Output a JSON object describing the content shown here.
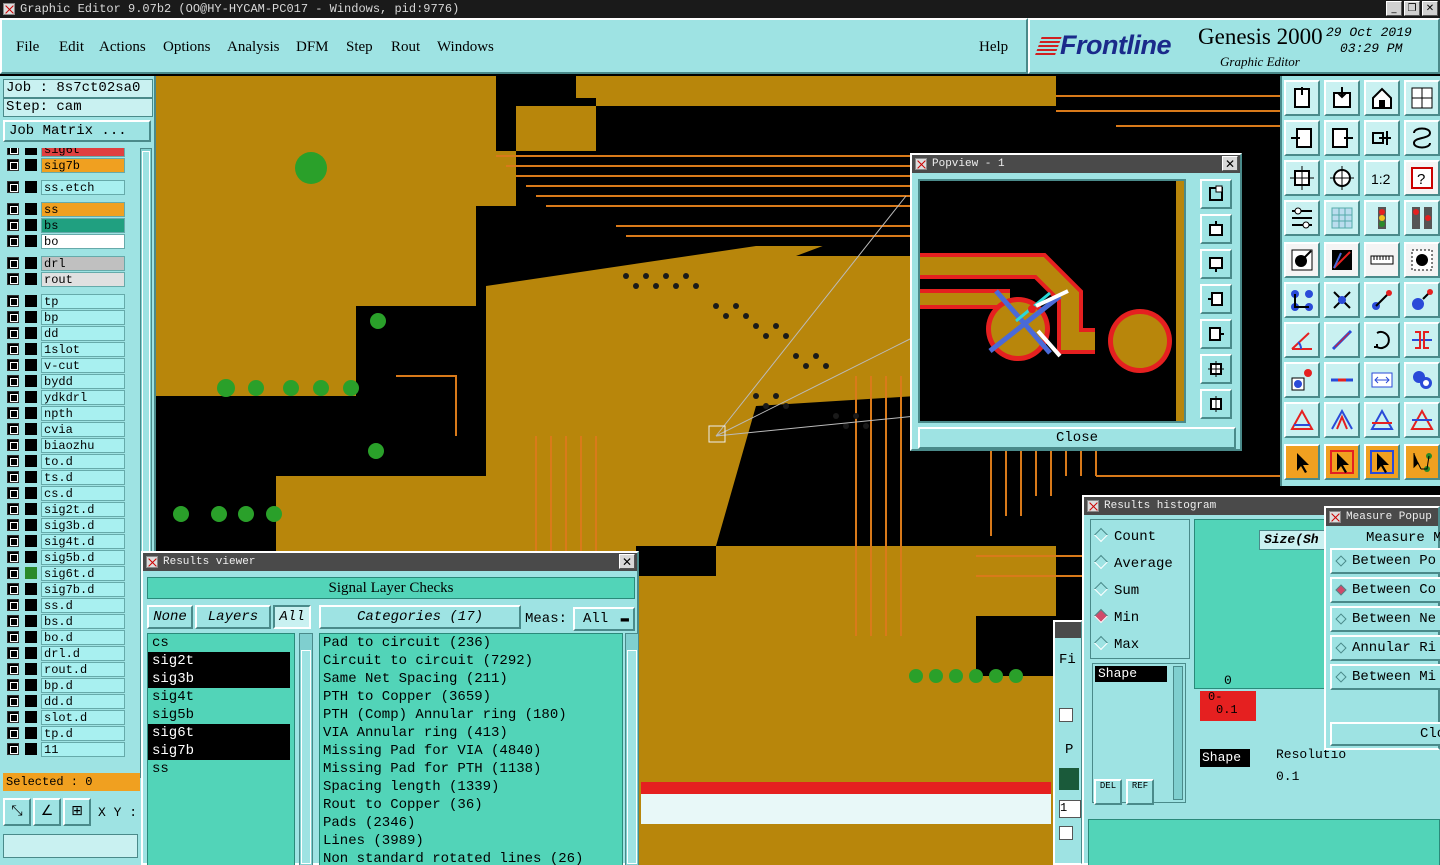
{
  "window": {
    "title": "Graphic Editor 9.07b2 (OO@HY-HYCAM-PC017 - Windows, pid:9776)",
    "buttons": [
      "_",
      "❐",
      "✕"
    ]
  },
  "menubar": {
    "items": [
      "File",
      "Edit",
      "Actions",
      "Options",
      "Analysis",
      "DFM",
      "Step",
      "Rout",
      "Windows"
    ],
    "help": "Help"
  },
  "brand": {
    "logo": "Frontline",
    "product": "Genesis 2000",
    "subtitle": "Graphic Editor",
    "date": "29 Oct 2019",
    "time": "03:29 PM"
  },
  "leftpanel": {
    "job": "Job : 8s7ct02sa0",
    "step": "Step: cam",
    "job_matrix": "Job Matrix ...",
    "selected": "Selected : 0",
    "xy_label": "X Y :",
    "layers": [
      {
        "name": "sig6t",
        "color": "#e04040"
      },
      {
        "name": "sig7b",
        "color": "#f0a020"
      },
      {
        "name": "ss.etch",
        "color": "#a8f0f0"
      },
      {
        "name": "ss",
        "color": "#f0a020"
      },
      {
        "name": "bs",
        "color": "#20a080"
      },
      {
        "name": "bo",
        "color": "#ffffff"
      },
      {
        "name": "drl",
        "color": "#c0c0c0"
      },
      {
        "name": "rout",
        "color": "#e0e0e0"
      },
      {
        "name": "tp",
        "color": "#a8f0f0"
      },
      {
        "name": "bp",
        "color": "#a8f0f0"
      },
      {
        "name": "dd",
        "color": "#a8f0f0"
      },
      {
        "name": "1slot",
        "color": "#a8f0f0"
      },
      {
        "name": "v-cut",
        "color": "#a8f0f0"
      },
      {
        "name": "bydd",
        "color": "#a8f0f0"
      },
      {
        "name": "ydkdrl",
        "color": "#a8f0f0"
      },
      {
        "name": "npth",
        "color": "#a8f0f0"
      },
      {
        "name": "cvia",
        "color": "#a8f0f0"
      },
      {
        "name": "biaozhu",
        "color": "#a8f0f0"
      },
      {
        "name": "to.d",
        "color": "#a8f0f0"
      },
      {
        "name": "ts.d",
        "color": "#a8f0f0"
      },
      {
        "name": "cs.d",
        "color": "#a8f0f0"
      },
      {
        "name": "sig2t.d",
        "color": "#a8f0f0"
      },
      {
        "name": "sig3b.d",
        "color": "#a8f0f0"
      },
      {
        "name": "sig4t.d",
        "color": "#a8f0f0"
      },
      {
        "name": "sig5b.d",
        "color": "#a8f0f0"
      },
      {
        "name": "sig6t.d",
        "color": "#a8f0f0"
      },
      {
        "name": "sig7b.d",
        "color": "#a8f0f0"
      },
      {
        "name": "ss.d",
        "color": "#a8f0f0"
      },
      {
        "name": "bs.d",
        "color": "#a8f0f0"
      },
      {
        "name": "bo.d",
        "color": "#a8f0f0"
      },
      {
        "name": "drl.d",
        "color": "#a8f0f0"
      },
      {
        "name": "rout.d",
        "color": "#a8f0f0"
      },
      {
        "name": "bp.d",
        "color": "#a8f0f0"
      },
      {
        "name": "dd.d",
        "color": "#a8f0f0"
      },
      {
        "name": "slot.d",
        "color": "#a8f0f0"
      },
      {
        "name": "tp.d",
        "color": "#a8f0f0"
      },
      {
        "name": "11",
        "color": "#a8f0f0"
      }
    ]
  },
  "popview": {
    "title": "Popview - 1",
    "close": "Close"
  },
  "results_viewer": {
    "title": "Results viewer",
    "header": "Signal Layer Checks",
    "none_btn": "None",
    "layers_btn": "Layers",
    "all_btn": "All",
    "categories_btn": "Categories (17)",
    "meas_label": "Meas:",
    "meas_value": "All",
    "layers": [
      "cs",
      "sig2t",
      "sig3b",
      "sig4t",
      "sig5b",
      "sig6t",
      "sig7b",
      "ss"
    ],
    "highlighted_layers": [
      "sig2t",
      "sig3b",
      "sig6t",
      "sig7b"
    ],
    "categories": [
      "Pad to circuit (236)",
      "Circuit to circuit (7292)",
      "Same Net Spacing (211)",
      "PTH to Copper (3659)",
      "PTH (Comp) Annular ring (180)",
      "VIA Annular ring (413)",
      "Missing Pad for VIA (4840)",
      "Missing Pad for PTH (1138)",
      "Spacing length (1339)",
      "Rout to Copper (36)",
      "Pads (2346)",
      "Lines (3989)",
      "Non standard rotated lines (26)"
    ]
  },
  "histogram": {
    "title": "Results histogram",
    "options": [
      "Count",
      "Average",
      "Sum",
      "Min",
      "Max"
    ],
    "selected": "Min",
    "shape_header": "Shape",
    "size_label": "Size(Sh",
    "zero": "0",
    "bar_label_1": "0-",
    "bar_label_2": "0.1",
    "shape2": "Shape",
    "resolution": "Resolutio",
    "resolution_value": "0.1",
    "del_btn": "DEL",
    "ref_btn": "REF"
  },
  "measure": {
    "title": "Measure Popup",
    "header": "Measure M",
    "options": [
      "Between Po",
      "Between Co",
      "Between Ne",
      "Annular Ri",
      "Between Mi"
    ],
    "selected_index": 1,
    "close": "Close"
  },
  "toolbar_icons": [
    "zoom-home-icon",
    "zoom-in-icon",
    "home-icon",
    "fit-icon",
    "pan-left-icon",
    "pan-right-icon",
    "zoom-back-icon",
    "redraw-icon",
    "fit-extent-icon",
    "center-icon",
    "scale-1-2-icon",
    "help-query-icon",
    "ruler-icon",
    "grid-icon",
    "layer-colors-icon",
    "layer-setup-icon",
    "snap-pad-icon",
    "snap-red-icon",
    "measure-ruler-icon",
    "snap-circle-icon",
    "net-connect-icon",
    "net-cross-icon",
    "net-line-icon",
    "net-point-icon",
    "angle-icon",
    "slash-icon",
    "arc-icon",
    "flip-icon",
    "pad-select-icon",
    "line-red-icon",
    "frame-select-icon",
    "cluster-icon",
    "triangle-icon",
    "triangle-2-icon",
    "triangle-3-icon",
    "triangle-4-icon",
    "pointer-icon",
    "pointer-box-icon",
    "pointer-2-icon",
    "pointer-net-icon"
  ]
}
